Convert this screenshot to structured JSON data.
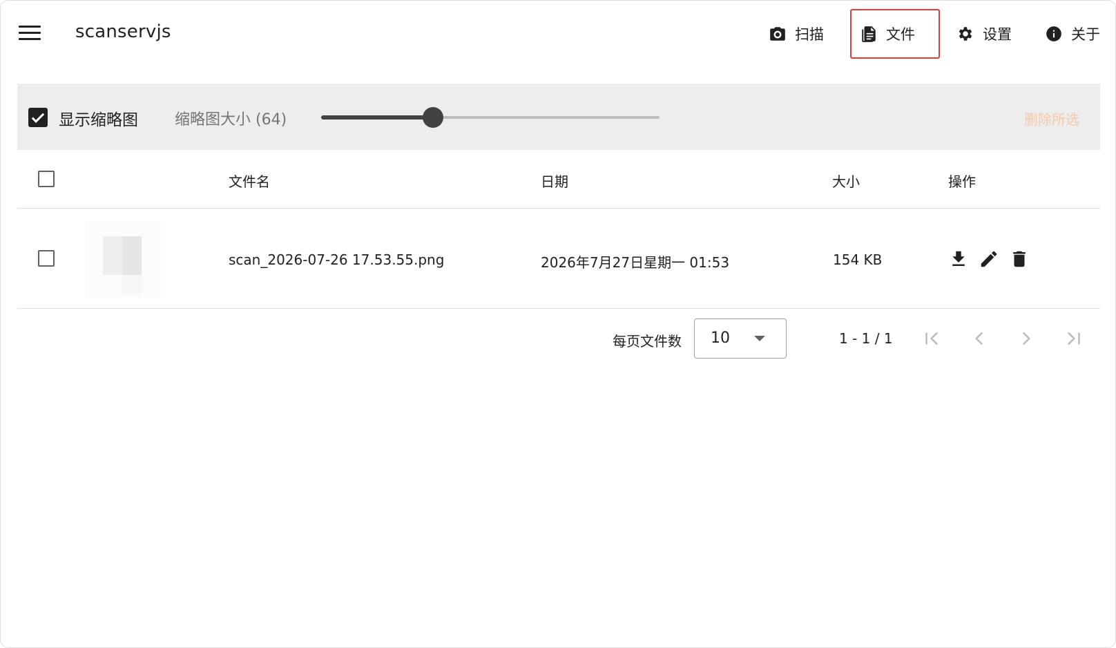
{
  "app": {
    "title": "scanservjs"
  },
  "nav": [
    {
      "label": "扫描",
      "icon": "camera-icon"
    },
    {
      "label": "文件",
      "icon": "document-icon",
      "active": true
    },
    {
      "label": "设置",
      "icon": "gear-icon"
    },
    {
      "label": "关于",
      "icon": "info-icon"
    }
  ],
  "toolbar": {
    "show_thumbnails_label": "显示缩略图",
    "show_thumbnails_checked": true,
    "thumbnail_size_label": "缩略图大小 (64)",
    "thumbnail_size_value": 64,
    "thumbnail_slider_fraction": 0.33,
    "delete_selected_label": "删除所选",
    "delete_selected_color": "#f6c9a6"
  },
  "table": {
    "headers": {
      "filename": "文件名",
      "date": "日期",
      "size": "大小",
      "actions": "操作"
    },
    "rows": [
      {
        "filename": "scan_2026-07-26 17.53.55.png",
        "date": "2026年7月27日星期一 01:53",
        "size": "154 KB",
        "actions": [
          "download-icon",
          "edit-icon",
          "delete-icon"
        ]
      }
    ]
  },
  "pagination": {
    "per_page_label": "每页文件数",
    "per_page_value": "10",
    "range_text": "1 - 1 / 1"
  },
  "colors": {
    "active_outline": "#e53935",
    "toolbar_bg": "#ededed",
    "slider": "#424242"
  }
}
